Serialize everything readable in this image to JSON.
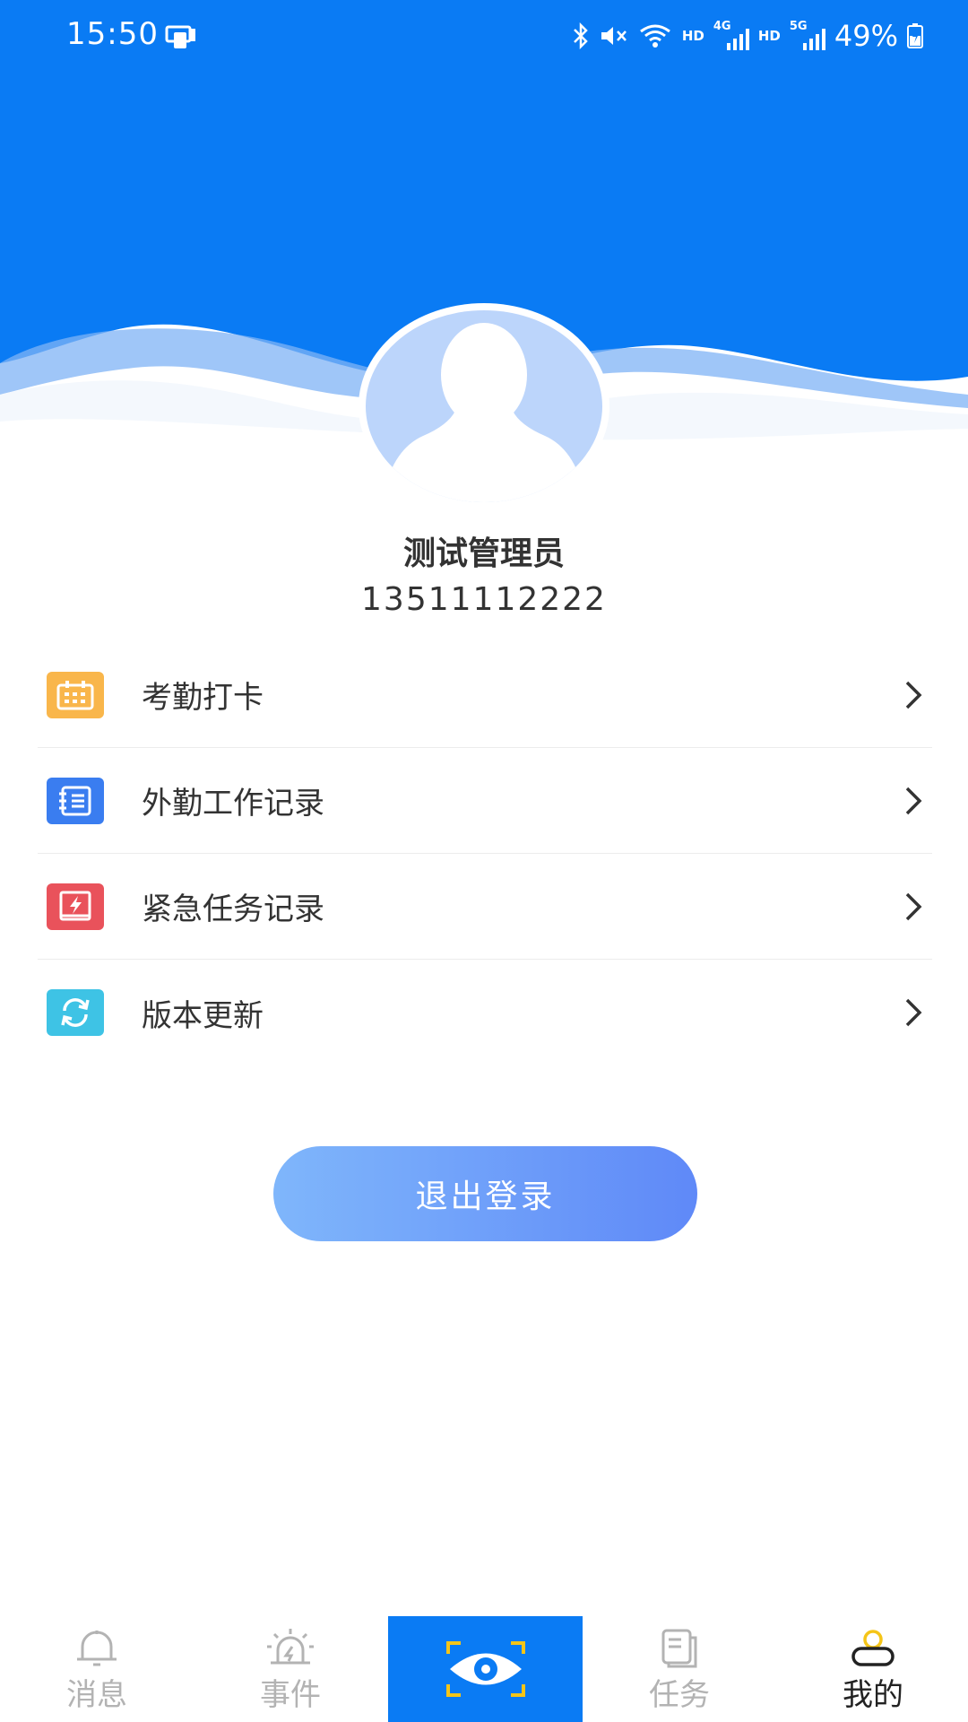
{
  "status_bar": {
    "time": "15:50",
    "hd1": "HD",
    "net1": "4G",
    "hd2": "HD",
    "net2": "5G",
    "battery": "49%"
  },
  "colors": {
    "brand_blue": "#0a7bf4",
    "avatar_bg": "#bcd5fb",
    "calendar_icon": "#f9b64b",
    "notebook_icon": "#3a7df0",
    "urgent_icon": "#e9525b",
    "update_icon": "#3ec3e5"
  },
  "profile": {
    "name": "测试管理员",
    "phone": "13511112222"
  },
  "menu": {
    "items": [
      {
        "label": "考勤打卡",
        "icon": "calendar-icon"
      },
      {
        "label": "外勤工作记录",
        "icon": "notebook-icon"
      },
      {
        "label": "紧急任务记录",
        "icon": "urgent-task-icon"
      },
      {
        "label": "版本更新",
        "icon": "refresh-icon"
      }
    ]
  },
  "logout": {
    "label": "退出登录"
  },
  "tabbar": {
    "tabs": [
      {
        "label": "消息",
        "icon": "bell-icon"
      },
      {
        "label": "事件",
        "icon": "alarm-icon"
      },
      {
        "label": "",
        "icon": "eye-scan-icon"
      },
      {
        "label": "任务",
        "icon": "documents-icon"
      },
      {
        "label": "我的",
        "icon": "user-icon"
      }
    ],
    "active": "我的"
  }
}
